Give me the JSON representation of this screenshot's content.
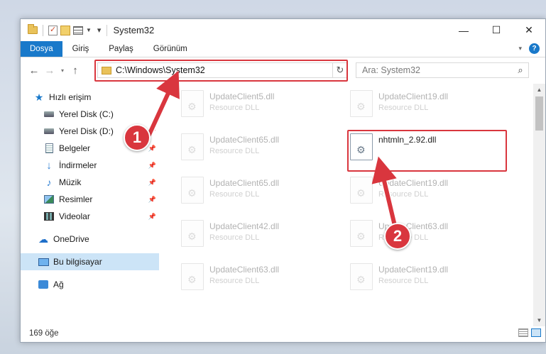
{
  "window": {
    "title": "System32",
    "minimize": "—",
    "maximize": "☐",
    "close": "✕"
  },
  "ribbon": {
    "tabs": [
      "Dosya",
      "Giriş",
      "Paylaş",
      "Görünüm"
    ],
    "help": "?"
  },
  "nav": {
    "address": "C:\\Windows\\System32",
    "search_placeholder": "Ara: System32"
  },
  "sidebar": {
    "items": [
      {
        "label": "Hızlı erişim",
        "icon": "star-icon"
      },
      {
        "label": "Yerel Disk (C:)",
        "icon": "disk-icon"
      },
      {
        "label": "Yerel Disk (D:)",
        "icon": "disk-icon"
      },
      {
        "label": "Belgeler",
        "icon": "document-icon"
      },
      {
        "label": "İndirmeler",
        "icon": "download-icon"
      },
      {
        "label": "Müzik",
        "icon": "music-icon"
      },
      {
        "label": "Resimler",
        "icon": "pictures-icon"
      },
      {
        "label": "Videolar",
        "icon": "videos-icon"
      },
      {
        "label": "OneDrive",
        "icon": "cloud-icon"
      },
      {
        "label": "Bu bilgisayar",
        "icon": "computer-icon"
      },
      {
        "label": "Ağ",
        "icon": "network-icon"
      }
    ]
  },
  "files": [
    {
      "name": "UpdateClient5.dll",
      "type": "Resource DLL"
    },
    {
      "name": "UpdateClient19.dll",
      "type": "Resource DLL"
    },
    {
      "name": "UpdateClient65.dll",
      "type": "Resource DLL"
    },
    {
      "name": "nhtmln_2.92.dll",
      "type": ""
    },
    {
      "name": "UpdateClient65.dll",
      "type": "Resource DLL"
    },
    {
      "name": "UpdateClient19.dll",
      "type": "Resource DLL"
    },
    {
      "name": "UpdateClient42.dll",
      "type": "Resource DLL"
    },
    {
      "name": "UpdateClient63.dll",
      "type": "Resource DLL"
    },
    {
      "name": "UpdateClient63.dll",
      "type": "Resource DLL"
    },
    {
      "name": "UpdateClient19.dll",
      "type": "Resource DLL"
    }
  ],
  "status": {
    "count": "169 öğe"
  },
  "callouts": {
    "one": "1",
    "two": "2"
  },
  "colors": {
    "accent": "#1979ca",
    "highlight": "#d9363e",
    "selected": "#cce4f7"
  }
}
